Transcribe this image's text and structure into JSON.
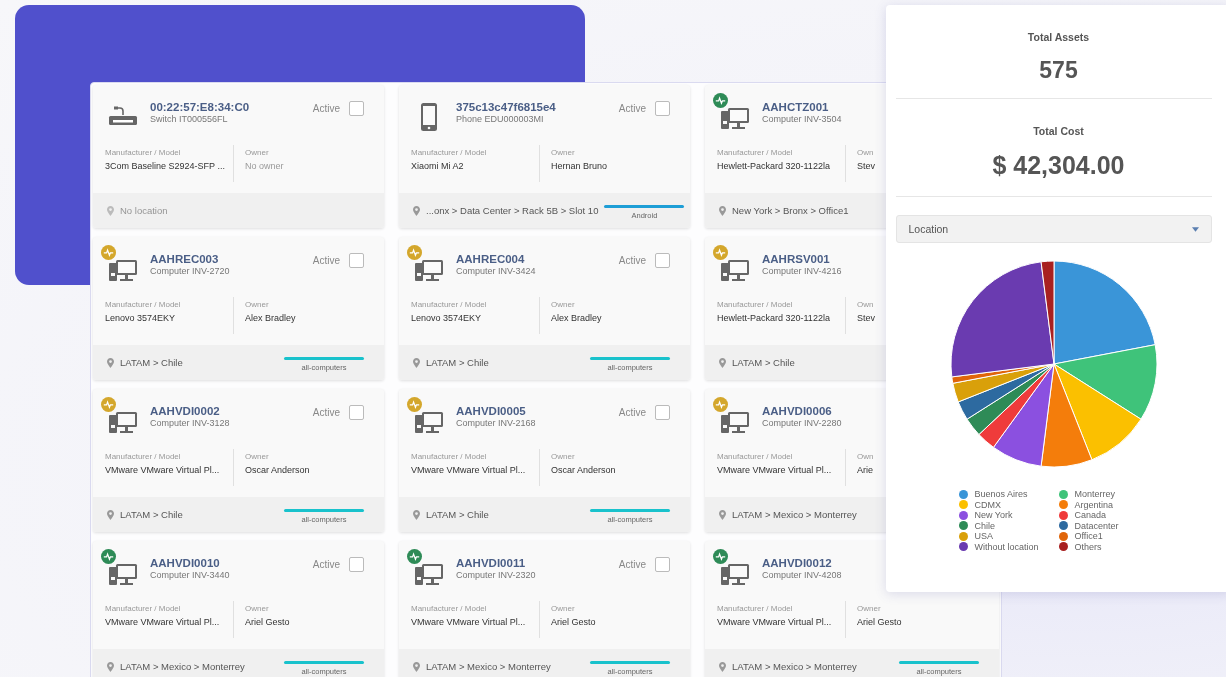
{
  "cards": [
    {
      "kind": "switch",
      "title": "00:22:57:E8:34:C0",
      "subtitle": "Switch IT000556FL",
      "active_label": "Active",
      "checked": false,
      "model_label": "Manufacturer / Model",
      "model": "3Com Baseline S2924-SFP ...",
      "owner_label": "Owner",
      "owner": "No owner",
      "owner_empty": true,
      "location": "No location",
      "location_empty": true
    },
    {
      "kind": "phone",
      "title": "375c13c47f6815e4",
      "subtitle": "Phone EDU000003MI",
      "active_label": "Active",
      "checked": false,
      "model_label": "Manufacturer / Model",
      "model": "Xiaomi Mi A2",
      "owner_label": "Owner",
      "owner": "Hernan Bruno",
      "owner_empty": false,
      "location": "...onx > Data Center > Rack 5B > Slot 10",
      "location_empty": false,
      "tag": {
        "label": "Android",
        "color": "#1e9ed6"
      }
    },
    {
      "kind": "computer",
      "color": "#2e8b57",
      "title": "AAHCTZ001",
      "subtitle": "Computer INV-3504",
      "model_label": "Manufacturer / Model",
      "model": "Hewlett-Packard 320-1122la",
      "owner_label": "Own",
      "owner": "Stev",
      "owner_empty": false,
      "location": "New York > Bronx > Office1",
      "location_empty": false
    },
    {
      "kind": "computer",
      "color": "#d4a72c",
      "title": "AAHREC003",
      "subtitle": "Computer INV-2720",
      "active_label": "Active",
      "checked": false,
      "model_label": "Manufacturer / Model",
      "model": "Lenovo 3574EKY",
      "owner_label": "Owner",
      "owner": "Alex Bradley",
      "owner_empty": false,
      "location": "LATAM > Chile",
      "location_empty": false,
      "tag": {
        "label": "all-computers",
        "color": "#19c2cc"
      }
    },
    {
      "kind": "computer",
      "color": "#d4a72c",
      "title": "AAHREC004",
      "subtitle": "Computer INV-3424",
      "active_label": "Active",
      "checked": false,
      "model_label": "Manufacturer / Model",
      "model": "Lenovo 3574EKY",
      "owner_label": "Owner",
      "owner": "Alex Bradley",
      "owner_empty": false,
      "location": "LATAM > Chile",
      "location_empty": false,
      "tag": {
        "label": "all-computers",
        "color": "#19c2cc"
      }
    },
    {
      "kind": "computer",
      "color": "#d4a72c",
      "title": "AAHRSV001",
      "subtitle": "Computer INV-4216",
      "model_label": "Manufacturer / Model",
      "model": "Hewlett-Packard 320-1122la",
      "owner_label": "Own",
      "owner": "Stev",
      "owner_empty": false,
      "location": "LATAM > Chile",
      "location_empty": false
    },
    {
      "kind": "computer",
      "color": "#d4a72c",
      "title": "AAHVDI0002",
      "subtitle": "Computer INV-3128",
      "active_label": "Active",
      "checked": false,
      "model_label": "Manufacturer / Model",
      "model": "VMware VMware Virtual Pl...",
      "owner_label": "Owner",
      "owner": "Oscar Anderson",
      "owner_empty": false,
      "location": "LATAM > Chile",
      "location_empty": false,
      "tag": {
        "label": "all-computers",
        "color": "#19c2cc"
      }
    },
    {
      "kind": "computer",
      "color": "#d4a72c",
      "title": "AAHVDI0005",
      "subtitle": "Computer INV-2168",
      "active_label": "Active",
      "checked": false,
      "model_label": "Manufacturer / Model",
      "model": "VMware VMware Virtual Pl...",
      "owner_label": "Owner",
      "owner": "Oscar Anderson",
      "owner_empty": false,
      "location": "LATAM > Chile",
      "location_empty": false,
      "tag": {
        "label": "all-computers",
        "color": "#19c2cc"
      }
    },
    {
      "kind": "computer",
      "color": "#d4a72c",
      "title": "AAHVDI0006",
      "subtitle": "Computer INV-2280",
      "model_label": "Manufacturer / Model",
      "model": "VMware VMware Virtual Pl...",
      "owner_label": "Own",
      "owner": "Arie",
      "owner_empty": false,
      "location": "LATAM > Mexico > Monterrey",
      "location_empty": false
    },
    {
      "kind": "computer",
      "color": "#2e8b57",
      "title": "AAHVDI0010",
      "subtitle": "Computer INV-3440",
      "active_label": "Active",
      "checked": false,
      "model_label": "Manufacturer / Model",
      "model": "VMware VMware Virtual Pl...",
      "owner_label": "Owner",
      "owner": "Ariel Gesto",
      "owner_empty": false,
      "location": "LATAM > Mexico > Monterrey",
      "location_empty": false,
      "tag": {
        "label": "all-computers",
        "color": "#19c2cc"
      }
    },
    {
      "kind": "computer",
      "color": "#2e8b57",
      "title": "AAHVDI0011",
      "subtitle": "Computer INV-2320",
      "active_label": "Active",
      "checked": false,
      "model_label": "Manufacturer / Model",
      "model": "VMware VMware Virtual Pl...",
      "owner_label": "Owner",
      "owner": "Ariel Gesto",
      "owner_empty": false,
      "location": "LATAM > Mexico > Monterrey",
      "location_empty": false,
      "tag": {
        "label": "all-computers",
        "color": "#19c2cc"
      }
    },
    {
      "kind": "computer",
      "color": "#2e8b57",
      "title": "AAHVDI0012",
      "subtitle": "Computer INV-4208",
      "model_label": "Manufacturer / Model",
      "model": "VMware VMware Virtual Pl...",
      "owner_label": "Owner",
      "owner": "Ariel Gesto",
      "owner_empty": false,
      "location": "LATAM > Mexico > Monterrey",
      "location_empty": false,
      "tag": {
        "label": "all-computers",
        "color": "#19c2cc"
      }
    }
  ],
  "summary": {
    "assets_label": "Total Assets",
    "assets": "575",
    "cost_label": "Total Cost",
    "cost": "$ 42,304.00",
    "group_by": {
      "value": "Location"
    },
    "legend": [
      {
        "label": "Buenos Aires",
        "color": "#3a95d8"
      },
      {
        "label": "Monterrey",
        "color": "#3fc37a"
      },
      {
        "label": "CDMX",
        "color": "#fbc000"
      },
      {
        "label": "Argentina",
        "color": "#f47d0b"
      },
      {
        "label": "New York",
        "color": "#8b50e0"
      },
      {
        "label": "Canada",
        "color": "#ef3b3b"
      },
      {
        "label": "Chile",
        "color": "#2e8b57"
      },
      {
        "label": "Datacenter",
        "color": "#2d6aa0"
      },
      {
        "label": "USA",
        "color": "#d9a00a"
      },
      {
        "label": "Office1",
        "color": "#e0650a"
      },
      {
        "label": "Without location",
        "color": "#6a3bb0"
      },
      {
        "label": "Others",
        "color": "#a82020"
      }
    ]
  }
}
